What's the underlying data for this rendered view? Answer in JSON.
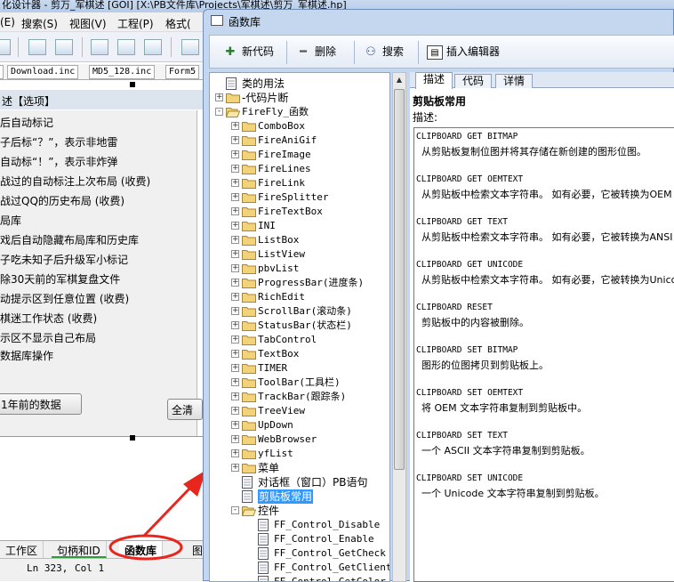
{
  "window_title": "化设计器 - 剪万_军棋述 [GOI] [X:\\PB文件库\\Projects\\军棋述\\剪万_军棋述.hp]",
  "menu": [
    "(E)",
    "搜索(S)",
    "视图(V)",
    "工程(P)",
    "格式("
  ],
  "file_tabs": [
    "Download.inc",
    "MD5_128.inc",
    "Form5"
  ],
  "options_panel": {
    "title": "述【选项】",
    "items": [
      "后自动标记",
      "子后标“？”，表示非地雷",
      "自动标“！”，表示非炸弹",
      "战过的自动标注上次布局 (收费)",
      "战过QQ的历史布局 (收费)",
      "局库",
      "戏后自动隐藏布局库和历史库",
      "子吃未知子后升级军小标记",
      "除30天前的军棋复盘文件",
      "动提示区到任意位置 (收费)",
      "棋迷工作状态 (收费)",
      "示区不显示自己布局"
    ],
    "group_label": "数据库操作",
    "btn_old": "1年前的数据",
    "btn_clear": "全清"
  },
  "bottom_tabs": [
    "工作区",
    "句柄和ID",
    "函数库",
    "图"
  ],
  "status": {
    "ln": "Ln 323,",
    "col": "Col 1"
  },
  "dialog": {
    "title": "函数库",
    "toolbar": {
      "new": "新代码",
      "delete": "删除",
      "search": "搜索",
      "insert": "插入编辑器"
    },
    "tree": [
      {
        "label": "类的用法",
        "icon": "doc",
        "level": 0,
        "expander": ""
      },
      {
        "label": "-代码片断",
        "icon": "folder",
        "level": 0,
        "expander": "+"
      },
      {
        "label": "FireFly_函数",
        "icon": "folder-open",
        "level": 0,
        "expander": "-"
      },
      {
        "label": "ComboBox",
        "icon": "folder",
        "level": 1,
        "expander": "+"
      },
      {
        "label": "FireAniGif",
        "icon": "folder",
        "level": 1,
        "expander": "+"
      },
      {
        "label": "FireImage",
        "icon": "folder",
        "level": 1,
        "expander": "+"
      },
      {
        "label": "FireLines",
        "icon": "folder",
        "level": 1,
        "expander": "+"
      },
      {
        "label": "FireLink",
        "icon": "folder",
        "level": 1,
        "expander": "+"
      },
      {
        "label": "FireSplitter",
        "icon": "folder",
        "level": 1,
        "expander": "+"
      },
      {
        "label": "FireTextBox",
        "icon": "folder",
        "level": 1,
        "expander": "+"
      },
      {
        "label": "INI",
        "icon": "folder",
        "level": 1,
        "expander": "+"
      },
      {
        "label": "ListBox",
        "icon": "folder",
        "level": 1,
        "expander": "+"
      },
      {
        "label": "ListView",
        "icon": "folder",
        "level": 1,
        "expander": "+"
      },
      {
        "label": "pbvList",
        "icon": "folder",
        "level": 1,
        "expander": "+"
      },
      {
        "label": "ProgressBar(进度条)",
        "icon": "folder",
        "level": 1,
        "expander": "+"
      },
      {
        "label": "RichEdit",
        "icon": "folder",
        "level": 1,
        "expander": "+"
      },
      {
        "label": "ScrollBar(滚动条)",
        "icon": "folder",
        "level": 1,
        "expander": "+"
      },
      {
        "label": "StatusBar(状态栏)",
        "icon": "folder",
        "level": 1,
        "expander": "+"
      },
      {
        "label": "TabControl",
        "icon": "folder",
        "level": 1,
        "expander": "+"
      },
      {
        "label": "TextBox",
        "icon": "folder",
        "level": 1,
        "expander": "+"
      },
      {
        "label": "TIMER",
        "icon": "folder",
        "level": 1,
        "expander": "+"
      },
      {
        "label": "ToolBar(工具栏)",
        "icon": "folder",
        "level": 1,
        "expander": "+"
      },
      {
        "label": "TrackBar(跟踪条)",
        "icon": "folder",
        "level": 1,
        "expander": "+"
      },
      {
        "label": "TreeView",
        "icon": "folder",
        "level": 1,
        "expander": "+"
      },
      {
        "label": "UpDown",
        "icon": "folder",
        "level": 1,
        "expander": "+"
      },
      {
        "label": "WebBrowser",
        "icon": "folder",
        "level": 1,
        "expander": "+"
      },
      {
        "label": "yfList",
        "icon": "folder",
        "level": 1,
        "expander": "+"
      },
      {
        "label": "菜单",
        "icon": "folder",
        "level": 1,
        "expander": "+"
      },
      {
        "label": "对话框（窗口）PB语句",
        "icon": "doc",
        "level": 1,
        "expander": ""
      },
      {
        "label": "剪贴板常用",
        "icon": "doc",
        "level": 1,
        "expander": "",
        "selected": true
      },
      {
        "label": "控件",
        "icon": "folder-open",
        "level": 1,
        "expander": "-"
      },
      {
        "label": "FF_Control_Disable",
        "icon": "doc",
        "level": 2,
        "expander": ""
      },
      {
        "label": "FF_Control_Enable",
        "icon": "doc",
        "level": 2,
        "expander": ""
      },
      {
        "label": "FF_Control_GetCheck",
        "icon": "doc",
        "level": 2,
        "expander": ""
      },
      {
        "label": "FF_Control_GetClient",
        "icon": "doc",
        "level": 2,
        "expander": ""
      },
      {
        "label": "FF_Control_GetColor",
        "icon": "doc",
        "level": 2,
        "expander": ""
      }
    ],
    "tabs": [
      "描述",
      "代码",
      "详情"
    ],
    "heading": "剪贴板常用",
    "desc_label": "描述:",
    "entries": [
      {
        "k": "CLIPBOARD GET BITMAP",
        "d": "从剪贴板复制位图并将其存储在新创建的图形位图。"
      },
      {
        "k": "CLIPBOARD GET OEMTEXT",
        "d": "从剪贴板中检索文本字符串。 如有必要，它被转换为OEM"
      },
      {
        "k": "CLIPBOARD GET TEXT",
        "d": "从剪贴板中检索文本字符串。 如有必要，它被转换为ANSI"
      },
      {
        "k": "CLIPBOARD GET UNICODE",
        "d": "从剪贴板中检索文本字符串。 如有必要，它被转换为Unicode"
      },
      {
        "k": "CLIPBOARD RESET",
        "d": "剪贴板中的内容被删除。"
      },
      {
        "k": "CLIPBOARD SET BITMAP",
        "d": "图形的位图拷贝到剪贴板上。"
      },
      {
        "k": "CLIPBOARD SET OEMTEXT",
        "d": "将 OEM 文本字符串复制到剪贴板中。"
      },
      {
        "k": "CLIPBOARD SET TEXT",
        "d": "一个 ASCII 文本字符串复制到剪贴板。"
      },
      {
        "k": "CLIPBOARD SET UNICODE",
        "d": "一个 Unicode 文本字符串复制到剪贴板。"
      }
    ]
  },
  "colors": {
    "dialog_frame": "#c5d7ee",
    "selection": "#3399ff",
    "annotation": "#e8261e",
    "folder": "#f3d37a"
  }
}
